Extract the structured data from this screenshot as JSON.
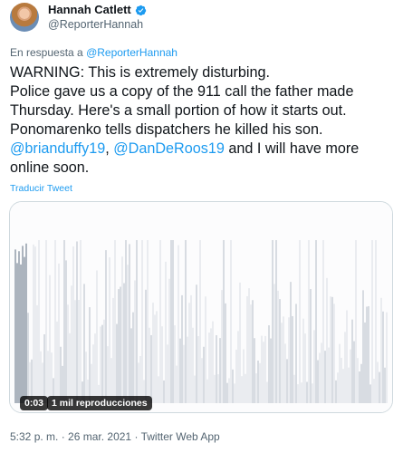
{
  "author": {
    "display_name": "Hannah Catlett",
    "handle": "@ReporterHannah",
    "verified": true,
    "avatar_icon": "profile-photo"
  },
  "reply": {
    "prefix": "En respuesta a ",
    "handle": "@ReporterHannah"
  },
  "tweet": {
    "line1": "WARNING: This is extremely disturbing.",
    "line2": "Police gave us a copy of the 911 call the father made Thursday. Here's a small portion of how it starts out. Ponomarenko tells dispatchers he killed his son.",
    "mention1": "@brianduffy19",
    "sep": ", ",
    "mention2": "@DanDeRoos19",
    "tail": " and I will have more online soon."
  },
  "translate_label": "Traducir Tweet",
  "video": {
    "time": "0:03",
    "views": "1 mil reproducciones"
  },
  "meta": {
    "time": "5:32 p. m.",
    "dot": " · ",
    "date": "26 mar. 2021",
    "source": "Twitter Web App"
  },
  "colors": {
    "accent": "#1d9bf0",
    "text": "#0f1419",
    "secondary": "#536471",
    "border": "#cfd9de"
  }
}
